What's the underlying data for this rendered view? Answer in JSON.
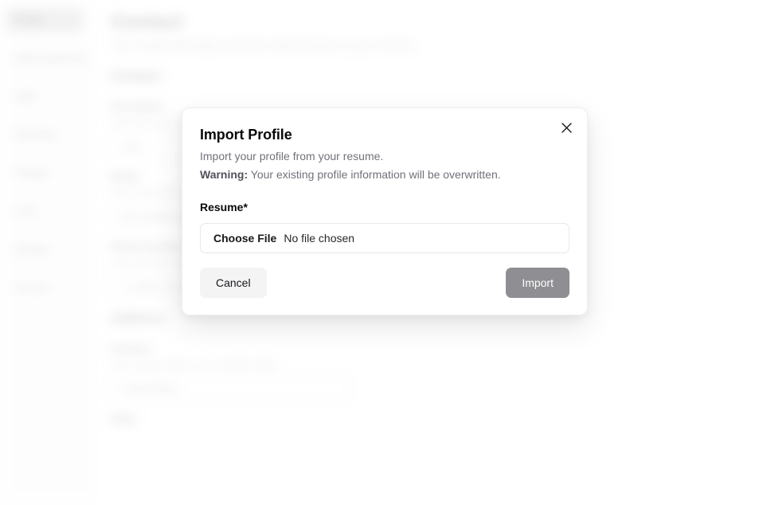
{
  "background": {
    "sidebar": {
      "items": [
        {
          "label": "Profile",
          "active": true
        },
        {
          "label": "Work Experience",
          "active": false
        },
        {
          "label": "Skills",
          "active": false
        },
        {
          "label": "Education",
          "active": false
        },
        {
          "label": "Projects",
          "active": false
        },
        {
          "label": "Links",
          "active": false
        },
        {
          "label": "Settings",
          "active": false
        },
        {
          "label": "Account",
          "active": false
        }
      ]
    },
    "main": {
      "page_title": "Contact",
      "page_subtitle": "Your contact information and how it will be shown on your resume.",
      "section_title": "Contact",
      "fields": [
        {
          "label": "First Name",
          "description": "Your first name as it should appear on your resume, this is what is used to appear on your resume.",
          "value": "John",
          "short": true
        },
        {
          "label": "Email",
          "description": "Your email address where recruiters can reach you.",
          "value": "john.doe@example.com",
          "short": true
        },
        {
          "label": "Phone Number",
          "description": "Your optional contact phone number with the country code.",
          "value": "+1 (555) 123-4567",
          "short": true
        }
      ],
      "section_title_2": "Address",
      "fields_2": [
        {
          "label": "Country",
          "description": "The country where you currently reside.",
          "value": "United States",
          "short": true
        },
        {
          "label": "State",
          "description": "",
          "value": "",
          "short": true
        }
      ]
    }
  },
  "modal": {
    "title": "Import Profile",
    "description": "Import your profile from your resume.",
    "warning_label": "Warning:",
    "warning_text": "Your existing profile information will be overwritten.",
    "close_icon": "close-icon",
    "field": {
      "label": "Resume*",
      "choose_file_label": "Choose File",
      "file_status": "No file chosen"
    },
    "actions": {
      "cancel_label": "Cancel",
      "import_label": "Import"
    }
  },
  "colors": {
    "title": "#09090b",
    "muted": "#71717a",
    "cancel_bg": "#f4f4f5",
    "import_bg": "#8e8e93",
    "sidebar_active_bg": "#d3d3d6"
  }
}
